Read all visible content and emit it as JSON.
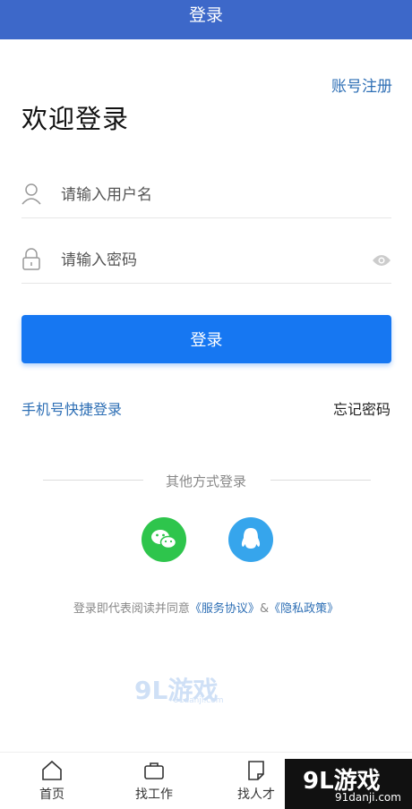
{
  "titlebar": {
    "title": "登录"
  },
  "register_link": "账号注册",
  "welcome": "欢迎登录",
  "username": {
    "placeholder": "请输入用户名"
  },
  "password": {
    "placeholder": "请输入密码"
  },
  "login_button": "登录",
  "quick_login": "手机号快捷登录",
  "forgot_password": "忘记密码",
  "other_methods": "其他方式登录",
  "social": [
    "wechat-icon",
    "qq-icon"
  ],
  "agreement": {
    "prefix": "登录即代表阅读并同意",
    "terms": "《服务协议》",
    "amp": "&",
    "privacy": "《隐私政策》"
  },
  "watermark": {
    "main": "9L游戏",
    "sub": "91danji.com"
  },
  "tabs": [
    {
      "label": "首页",
      "icon": "home-icon"
    },
    {
      "label": "找工作",
      "icon": "briefcase-icon"
    },
    {
      "label": "找人才",
      "icon": "resume-icon"
    }
  ],
  "colors": {
    "header": "#3d68c9",
    "primary": "#1677f2",
    "link": "#2e6fb5",
    "wechat": "#2ec54c",
    "qq": "#36a5ec"
  }
}
